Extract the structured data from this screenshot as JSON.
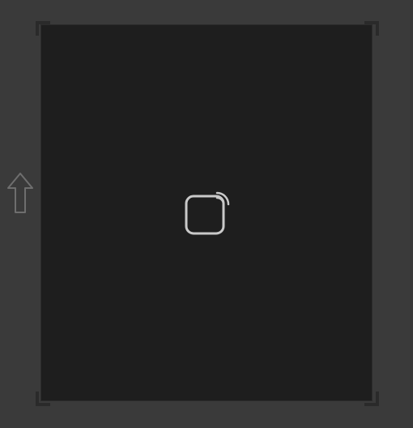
{
  "page": {
    "background_color": "#3a3a3a",
    "panel_color": "#1e1e1e"
  },
  "icons": {
    "center": "airplay-cast-icon",
    "left": "up-arrow-icon"
  }
}
